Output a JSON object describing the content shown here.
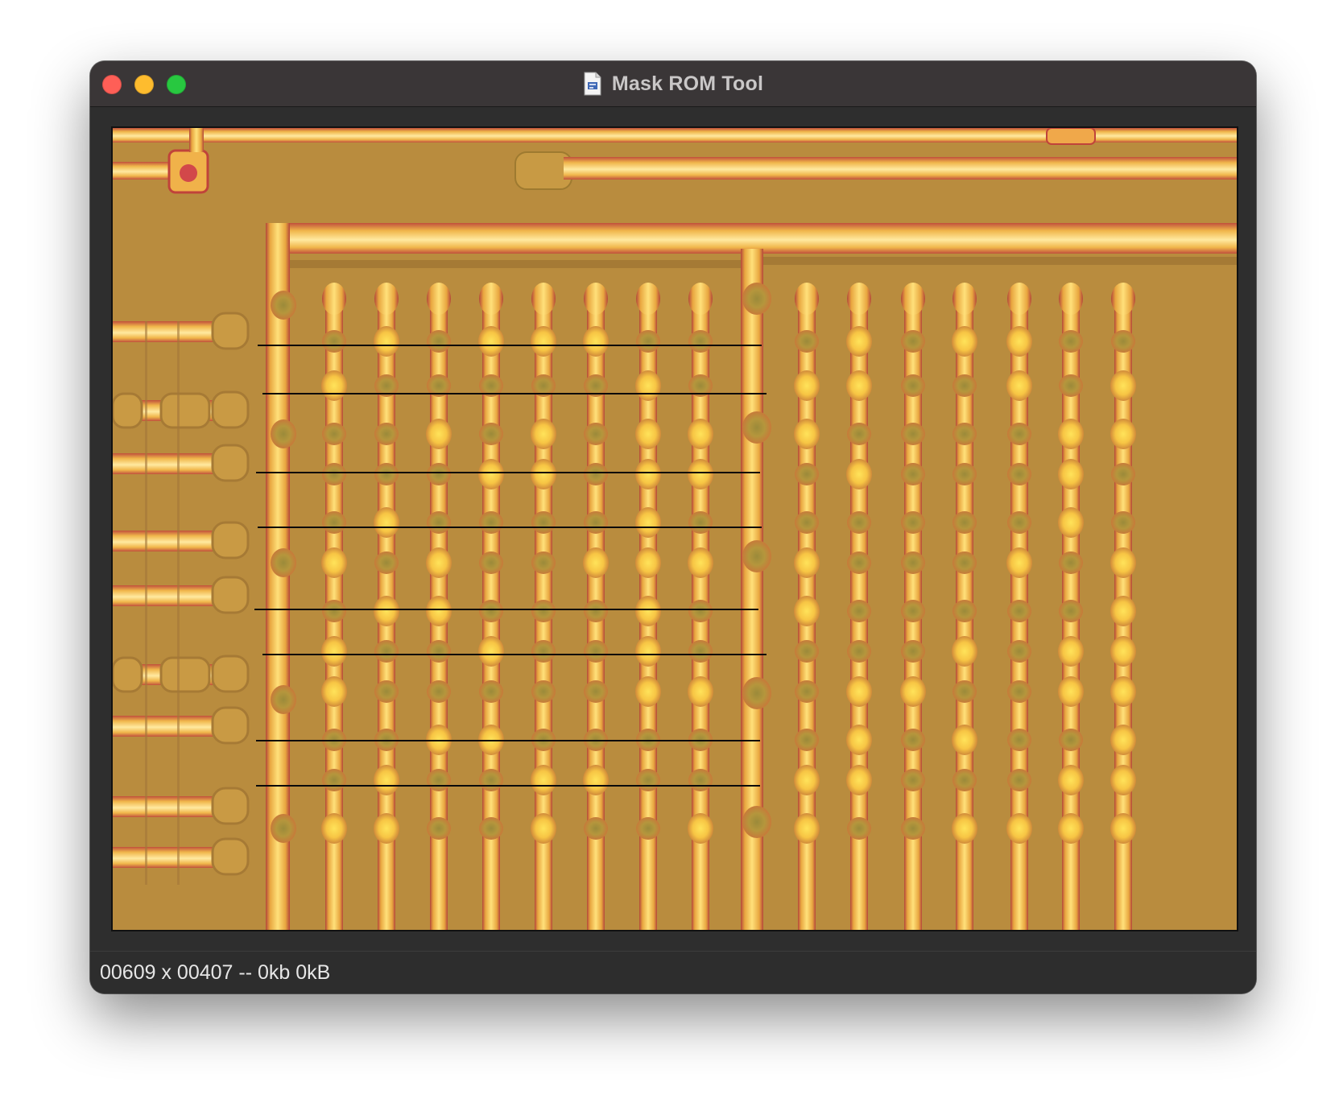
{
  "window": {
    "title": "Mask ROM Tool",
    "icon": "document-icon"
  },
  "controls": {
    "close": {
      "icon": "close-icon",
      "color": "#fe5f57"
    },
    "minimize": {
      "icon": "minimize-icon",
      "color": "#febc2e"
    },
    "zoom": {
      "icon": "zoom-icon",
      "color": "#28c840"
    }
  },
  "viewer": {
    "content": "die-photo-rom-bit-array",
    "row_lines_drawn": 8,
    "colors": {
      "substrate": "#b98c3e",
      "metal": "#f3c04a",
      "metal_highlight": "#ffe07a",
      "trace_edge": "#c0433a",
      "row_line": "#0a0a0a"
    }
  },
  "status": {
    "text": "00609 x 00407 -- 0kb 0kB"
  }
}
